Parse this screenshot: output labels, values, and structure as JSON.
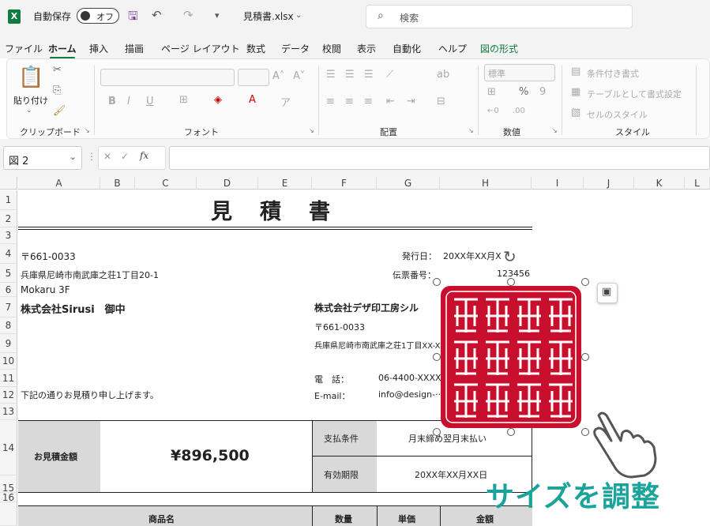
{
  "titlebar": {
    "autosave_label": "自動保存",
    "toggle_label": "オフ",
    "filename": "見積書.xlsx",
    "search_placeholder": "検索"
  },
  "menu": [
    "ファイル",
    "ホーム",
    "挿入",
    "描画",
    "ページ レイアウト",
    "数式",
    "データ",
    "校閲",
    "表示",
    "自動化",
    "ヘルプ",
    "図の形式"
  ],
  "ribbon": {
    "clipboard": {
      "paste_label": "貼り付け",
      "group_label": "クリップボード"
    },
    "font": {
      "group_label": "フォント",
      "bold": "B",
      "italic": "I",
      "underline": "U"
    },
    "alignment": {
      "group_label": "配置"
    },
    "number": {
      "group_label": "数値",
      "format": "標準"
    },
    "styles": {
      "group_label": "スタイル",
      "conditional": "条件付き書式",
      "table": "テーブルとして書式設定",
      "cell_styles": "セルのスタイル"
    }
  },
  "formula_bar": {
    "name_box": "図 2",
    "fx": "fx"
  },
  "columns": [
    "A",
    "B",
    "C",
    "D",
    "E",
    "F",
    "G",
    "H",
    "I",
    "J",
    "K",
    "L"
  ],
  "rows": [
    "1",
    "2",
    "3",
    "4",
    "5",
    "6",
    "7",
    "8",
    "9",
    "10",
    "11",
    "12",
    "13",
    "14",
    "15",
    "16"
  ],
  "sheet": {
    "title": "見　積　書",
    "postal": "〒661-0033",
    "address": "兵庫県尼崎市南武庫之荘1丁目20-1",
    "building": "Mokaru 3F",
    "client": "株式会社Sirusi　御中",
    "intro": "下記の通りお見積り申し上げます。",
    "issue_label": "発行日：",
    "issue_value": "20XX年XX月X",
    "slip_label": "伝票番号：",
    "slip_value": "123456",
    "company": "株式会社デザ印工房シル",
    "company_postal": "〒661-0033",
    "company_address": "兵庫県尼崎市南武庫之荘1丁目XX-X",
    "tel_label": "電　話：",
    "tel_value": "06-4400-XXXX",
    "email_label": "E-mail：",
    "email_value": "info@design-···.jp",
    "amount_label": "お見積金額",
    "amount_value": "¥896,500",
    "payment_label": "支払条件",
    "payment_value": "月末締め翌月末払い",
    "validity_label": "有効期限",
    "validity_value": "20XX年XX月XX日",
    "table_headers": [
      "商品名",
      "数量",
      "単価",
      "金額"
    ]
  },
  "stamp": {
    "color": "#c8102e",
    "characters": [
      "株",
      "式",
      "会",
      "社",
      "デ",
      "ザ",
      "印",
      "工",
      "房",
      "シ",
      "ル",
      "シ"
    ]
  },
  "overlay_caption": "サイズを調整"
}
